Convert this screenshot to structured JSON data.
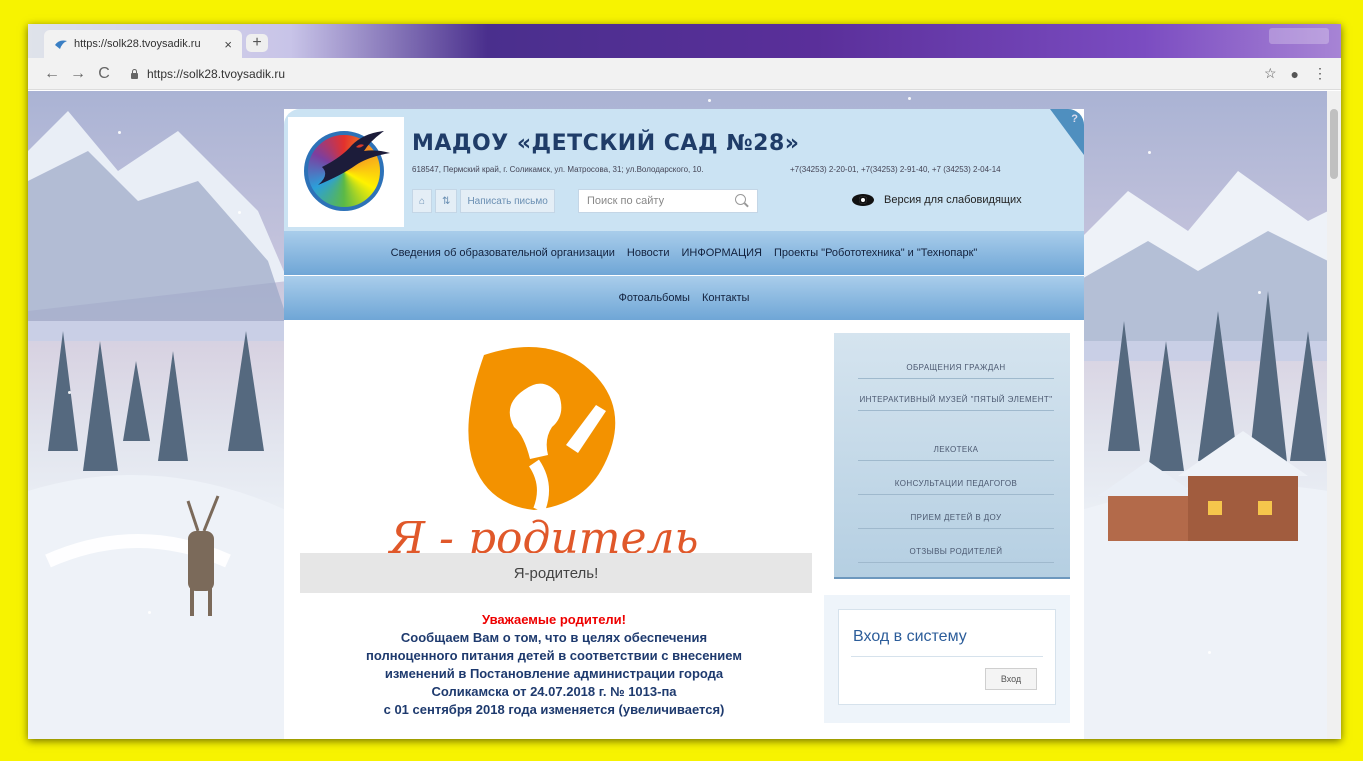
{
  "browser": {
    "tab_title": "https://solk28.tvoysadik.ru",
    "tab_close": "×",
    "new_tab": "+",
    "back": "←",
    "forward": "→",
    "reload": "C",
    "url": "https://solk28.tvoysadik.ru",
    "star": "☆",
    "profile": "●",
    "menu": "⋮"
  },
  "site": {
    "title": "МАДОУ «ДЕТСКИЙ САД №28»",
    "address": "618547, Пермский край, г. Соликамск, ул. Матросова, 31; ул.Володарского, 10.",
    "phones": "+7(34253) 2-20-01, +7(34253) 2-91-40, +7 (34253) 2-04-14",
    "home_icon": "⌂",
    "sitemap_icon": "⇅",
    "write_letter": "Написать письмо",
    "search_placeholder": "Поиск по сайту",
    "low_vision": "Версия для слабовидящих",
    "help": "?"
  },
  "nav": {
    "row1": [
      "Сведения об образовательной организации",
      "Новости",
      "ИНФОРМАЦИЯ",
      "Проекты \"Робототехника\" и \"Технопарк\""
    ],
    "row2": [
      "Фотоальбомы",
      "Контакты"
    ]
  },
  "hero": {
    "logo_text": "Я - родитель",
    "caption": "Я-родитель!"
  },
  "article": {
    "greeting": "Уважаемые родители!",
    "line1": "Сообщаем Вам о том, что в целях обеспечения",
    "line2": "полноценного питания детей в соответствии с внесением",
    "line3": "изменений в Постановление администрации города",
    "line4": "Соликамска от 24.07.2018 г. № 1013-па",
    "line5": "с 01 сентября 2018 года изменяется (увеличивается)"
  },
  "sidebar": {
    "items": [
      "ОБРАЩЕНИЯ ГРАЖДАН",
      "ИНТЕРАКТИВНЫЙ МУЗЕЙ \"ПЯТЫЙ ЭЛЕМЕНТ\"",
      "ЛЕКОТЕКА",
      "КОНСУЛЬТАЦИИ ПЕДАГОГОВ",
      "ПРИЕМ ДЕТЕЙ В ДОУ",
      "ОТЗЫВЫ РОДИТЕЛЕЙ"
    ]
  },
  "login": {
    "title": "Вход в систему",
    "button": "Вход"
  },
  "colors": {
    "frame_border": "#f7f300",
    "header_bg": "#cbe3f3",
    "nav_bg": "#6fa6d6",
    "title": "#1f3c68",
    "hero_orange": "#f39200",
    "greeting": "#ee0000"
  }
}
